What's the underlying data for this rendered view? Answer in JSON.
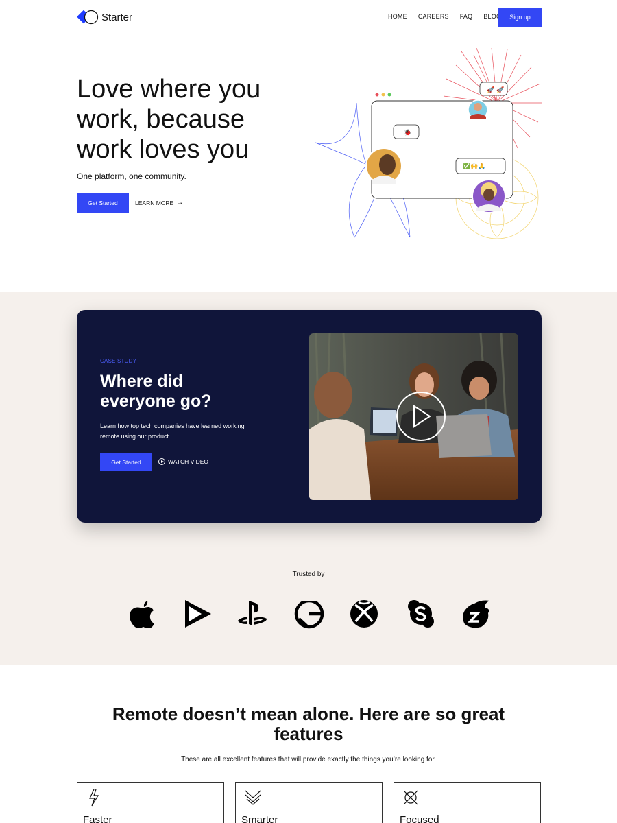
{
  "nav": {
    "brand": "Starter",
    "links": [
      "HOME",
      "CAREERS",
      "FAQ",
      "BLOG"
    ],
    "signup_label": "Sign up",
    "accent_color": "#3347f5"
  },
  "hero": {
    "title_lines": [
      "Love where you",
      "work, because",
      "work loves you"
    ],
    "subtitle": "One platform, one community.",
    "cta_label": "Get Started",
    "secondary_label": "LEARN MORE",
    "chat_emojis": [
      "🚀 🚀",
      "🐞",
      "✅🙌🙏"
    ]
  },
  "case_study": {
    "eyebrow": "CASE STUDY",
    "title_lines": [
      "Where did",
      "everyone go?"
    ],
    "text": "Learn how top tech companies have learned working remote using our product.",
    "cta_label": "Get Started",
    "video_label": "WATCH VIDEO",
    "card_color": "#10153a"
  },
  "trusted": {
    "label": "Trusted by",
    "brands": [
      "apple-icon",
      "google-play-icon",
      "playstation-icon",
      "gatsby-icon",
      "xbox-icon",
      "skype-icon",
      "zeit-icon"
    ]
  },
  "features": {
    "title_lines": [
      "Remote doesn’t mean alone. Here are so great",
      "features"
    ],
    "subtitle": "These are all excellent features that will provide exactly the things you’re looking for.",
    "items": [
      {
        "name": "Faster",
        "icon": "lightning-icon"
      },
      {
        "name": "Smarter",
        "icon": "chevrons-down-icon"
      },
      {
        "name": "Focused",
        "icon": "target-icon"
      }
    ]
  }
}
